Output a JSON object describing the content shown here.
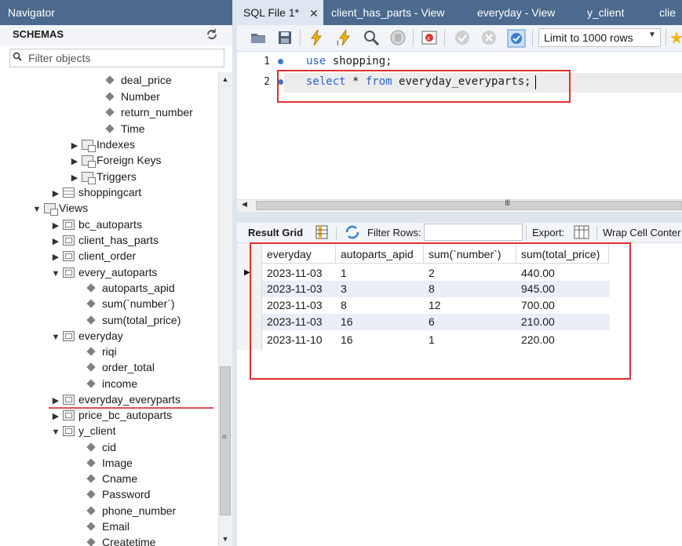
{
  "navigator": {
    "title": "Navigator",
    "schemas_label": "SCHEMAS",
    "filter_placeholder": "Filter objects",
    "tree": [
      {
        "label": "deal_price",
        "type": "column"
      },
      {
        "label": "Number",
        "type": "column"
      },
      {
        "label": "return_number",
        "type": "column"
      },
      {
        "label": "Time",
        "type": "column"
      },
      {
        "label": "Indexes",
        "type": "folder"
      },
      {
        "label": "Foreign Keys",
        "type": "folder"
      },
      {
        "label": "Triggers",
        "type": "folder"
      },
      {
        "label": "shoppingcart",
        "type": "table"
      },
      {
        "label": "Views",
        "type": "folder"
      },
      {
        "label": "bc_autoparts",
        "type": "view"
      },
      {
        "label": "client_has_parts",
        "type": "view"
      },
      {
        "label": "client_order",
        "type": "view"
      },
      {
        "label": "every_autoparts",
        "type": "view"
      },
      {
        "label": "autoparts_apid",
        "type": "column"
      },
      {
        "label": "sum(`number`)",
        "type": "column"
      },
      {
        "label": "sum(total_price)",
        "type": "column"
      },
      {
        "label": "everyday",
        "type": "view"
      },
      {
        "label": "riqi",
        "type": "column"
      },
      {
        "label": "order_total",
        "type": "column"
      },
      {
        "label": "income",
        "type": "column"
      },
      {
        "label": "everyday_everyparts",
        "type": "view"
      },
      {
        "label": "price_bc_autoparts",
        "type": "view"
      },
      {
        "label": "y_client",
        "type": "view"
      },
      {
        "label": "cid",
        "type": "column"
      },
      {
        "label": "Image",
        "type": "column"
      },
      {
        "label": "Cname",
        "type": "column"
      },
      {
        "label": "Password",
        "type": "column"
      },
      {
        "label": "phone_number",
        "type": "column"
      },
      {
        "label": "Email",
        "type": "column"
      },
      {
        "label": "Createtime",
        "type": "column"
      }
    ]
  },
  "tabs": [
    {
      "label": "SQL File 1*"
    },
    {
      "label": "client_has_parts - View"
    },
    {
      "label": "everyday - View"
    },
    {
      "label": "y_client"
    },
    {
      "label": "clie"
    }
  ],
  "toolbar": {
    "limit_label": "Limit to 1000 rows"
  },
  "editor": {
    "line_numbers": [
      "1",
      "2"
    ],
    "line1_kw": "use",
    "line1_rest": " shopping;",
    "line2_kw1": "select",
    "line2_mid": " * ",
    "line2_kw2": "from",
    "line2_rest": " everyday_everyparts;"
  },
  "result_toolbar": {
    "result_grid": "Result Grid",
    "filter_rows": "Filter Rows:",
    "export": "Export:",
    "wrap": "Wrap Cell Conter"
  },
  "grid": {
    "columns": [
      "everyday",
      "autoparts_apid",
      "sum(`number`)",
      "sum(total_price)"
    ],
    "rows": [
      [
        "2023-11-03",
        "1",
        "2",
        "440.00"
      ],
      [
        "2023-11-03",
        "3",
        "8",
        "945.00"
      ],
      [
        "2023-11-03",
        "8",
        "12",
        "700.00"
      ],
      [
        "2023-11-03",
        "16",
        "6",
        "210.00"
      ],
      [
        "2023-11-10",
        "16",
        "1",
        "220.00"
      ]
    ]
  },
  "colors": {
    "header_bar": "#4b6a8e",
    "keyword": "#2b63c9",
    "highlight_box": "#e03030"
  }
}
